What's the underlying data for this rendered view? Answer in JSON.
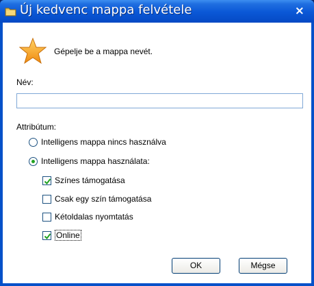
{
  "dialog": {
    "title": "Új kedvenc mappa felvétele",
    "close_label": "×",
    "prompt": "Gépelje be a mappa nevét.",
    "name_label": "Név:",
    "name_value": "",
    "attribute_label": "Attribútum:",
    "radio_options": [
      {
        "label": "Intelligens mappa nincs használva",
        "selected": false
      },
      {
        "label": "Intelligens mappa használata:",
        "selected": true
      }
    ],
    "checkboxes": [
      {
        "label": "Színes támogatása",
        "checked": true
      },
      {
        "label": "Csak egy szín támogatása",
        "checked": false
      },
      {
        "label": "Kétoldalas nyomtatás",
        "checked": false
      },
      {
        "label": "Online",
        "checked": true
      }
    ],
    "ok_label": "OK",
    "cancel_label": "Mégse"
  },
  "colors": {
    "titlebar": "#0a57d6",
    "accent_green": "#21a121",
    "star": "#f5a623"
  },
  "icons": {
    "title": "folder-icon",
    "prompt": "star-icon",
    "close": "close-icon"
  }
}
